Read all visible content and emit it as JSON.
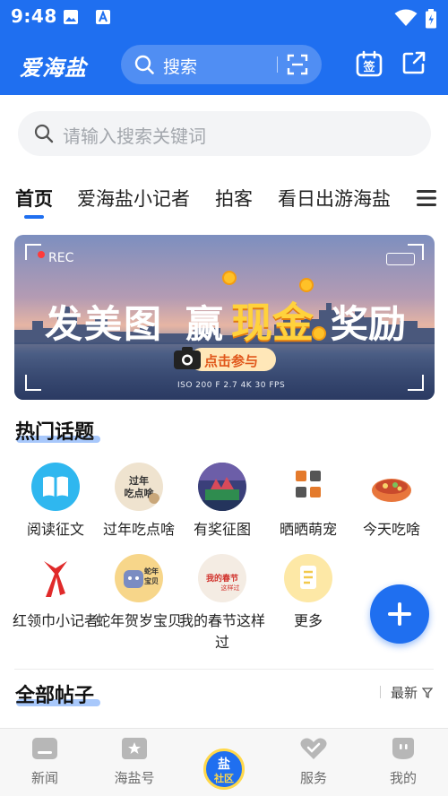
{
  "status_bar": {
    "time": "9:48"
  },
  "app_bar": {
    "logo": "爱海盐",
    "search_label": "搜索"
  },
  "search": {
    "placeholder": "请输入搜索关键词"
  },
  "tabs": [
    {
      "label": "首页",
      "active": true
    },
    {
      "label": "爱海盐小记者",
      "active": false
    },
    {
      "label": "拍客",
      "active": false
    },
    {
      "label": "看日出游海盐",
      "active": false
    }
  ],
  "banner": {
    "rec": "REC",
    "headline_1": "发美图",
    "headline_2": "赢",
    "headline_3": "现金",
    "headline_4": "奖励",
    "cta": "点击参与",
    "camera_info": "ISO 200   F 2.7   4K   30 FPS"
  },
  "hot_topics": {
    "title": "热门话题",
    "items": [
      {
        "label": "阅读征文",
        "icon": "book-icon"
      },
      {
        "label": "过年吃点啥",
        "icon": "new-year-food-icon"
      },
      {
        "label": "有奖征图",
        "icon": "photo-contest-icon"
      },
      {
        "label": "晒晒萌宠",
        "icon": "pets-icon"
      },
      {
        "label": "今天吃啥",
        "icon": "hotpot-icon"
      },
      {
        "label": "红领巾小记者",
        "icon": "red-scarf-icon"
      },
      {
        "label": "蛇年贺岁宝贝",
        "icon": "snake-year-baby-icon"
      },
      {
        "label": "我的春节这样过",
        "icon": "spring-festival-icon"
      },
      {
        "label": "更多",
        "icon": "more-icon"
      }
    ]
  },
  "all_posts": {
    "title": "全部帖子",
    "sort": "最新"
  },
  "bottom_nav": {
    "items": [
      {
        "label": "新闻",
        "icon": "news-icon"
      },
      {
        "label": "海盐号",
        "icon": "star-icon"
      },
      {
        "label": "社区",
        "icon": "community-icon",
        "badge_top": "盐",
        "badge_bottom": "社区"
      },
      {
        "label": "服务",
        "icon": "heart-icon"
      },
      {
        "label": "我的",
        "icon": "profile-icon"
      }
    ]
  },
  "colors": {
    "brand": "#1f6ff0",
    "accent_yellow": "#ffd84a"
  }
}
